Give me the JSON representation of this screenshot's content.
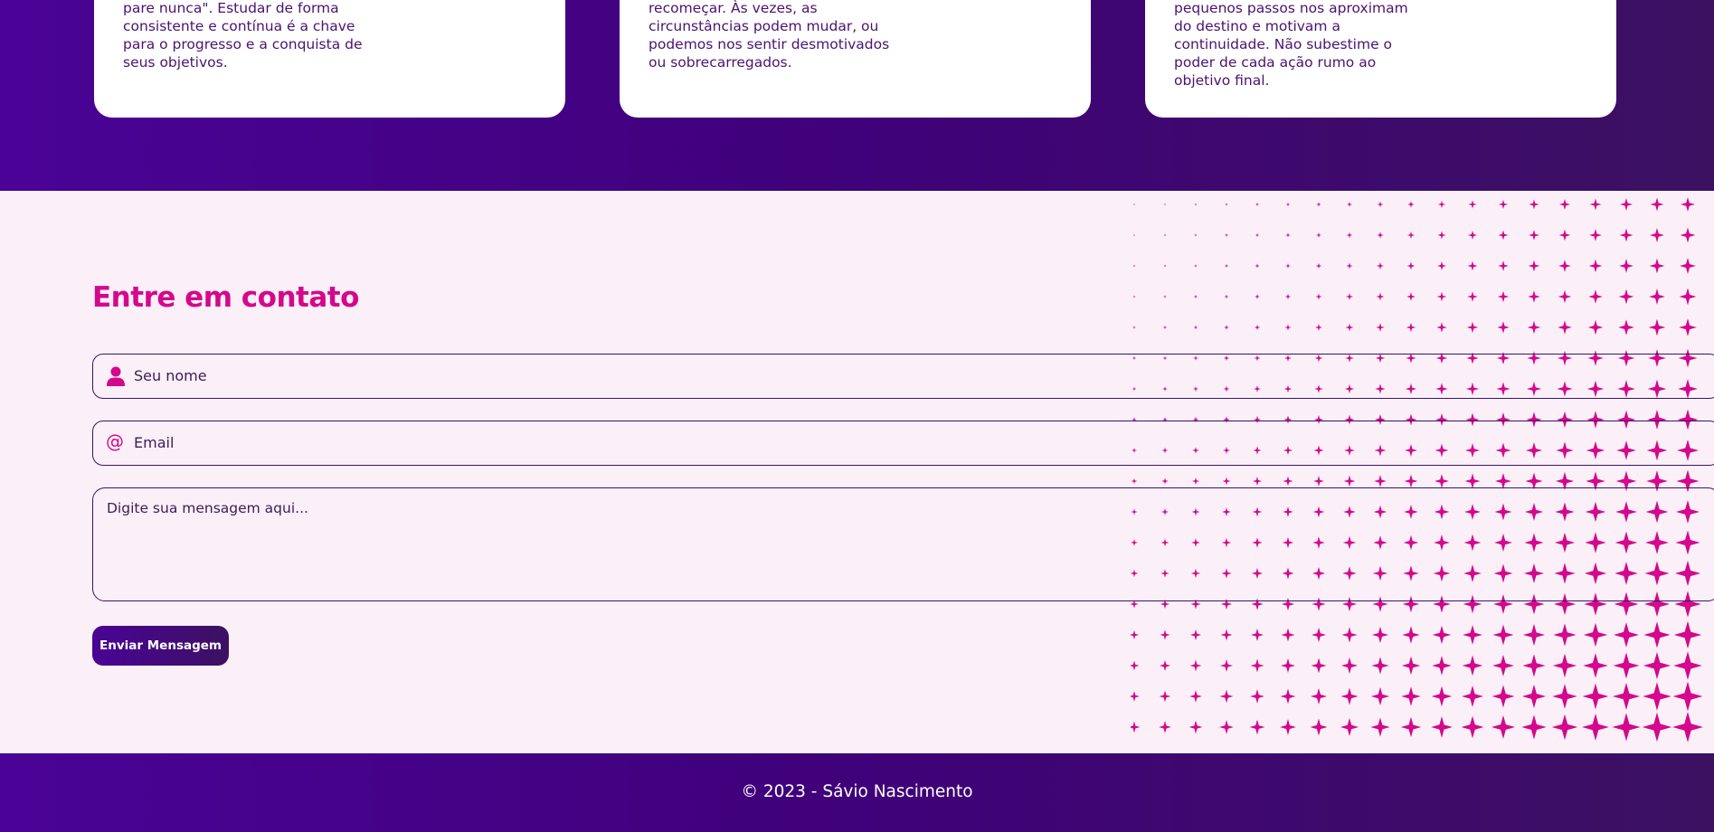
{
  "cards": [
    {
      "lines": [
        "pare nunca\". Estudar de forma",
        "consistente e contínua é a chave",
        "para o progresso e a conquista de",
        "seus objetivos."
      ]
    },
    {
      "lines": [
        "recomeçar. Às vezes, as",
        "circunstâncias podem mudar, ou",
        "podemos nos sentir desmotivados",
        "ou sobrecarregados."
      ]
    },
    {
      "lines": [
        "pequenos passos nos aproximam",
        "do destino e motivam a",
        "continuidade. Não subestime o",
        "poder de cada ação rumo ao",
        "objetivo final."
      ]
    }
  ],
  "contact": {
    "title": "Entre em contato",
    "name_placeholder": "Seu nome",
    "email_placeholder": "Email",
    "message_placeholder": "Digite sua mensagem aqui...",
    "send_label": "Enviar Mensagem"
  },
  "footer": {
    "text": "© 2023 - Sávio Nascimento"
  },
  "colors": {
    "accent": "#d4088c",
    "purple": "#4a0396",
    "background": "#fcf0f8"
  }
}
